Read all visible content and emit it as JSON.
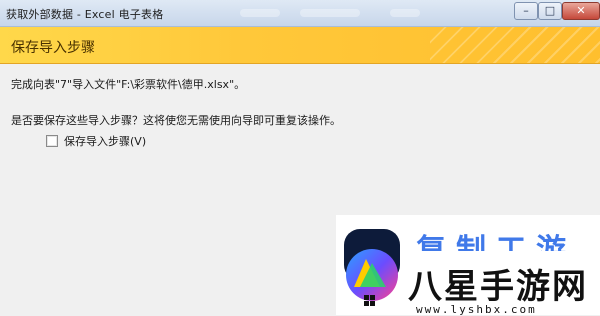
{
  "window": {
    "title": "获取外部数据 - Excel 电子表格",
    "buttons": {
      "minimize_icon": "minimize-icon",
      "maximize_icon": "maximize-icon",
      "close_icon": "close-icon",
      "minimize_glyph": "–",
      "maximize_glyph": "□",
      "close_glyph": "✕"
    }
  },
  "header": {
    "title": "保存导入步骤",
    "color": "#ffc83a"
  },
  "content": {
    "line1": "完成向表\"7\"导入文件\"F:\\彩票软件\\德甲.xlsx\"。",
    "line2": "是否要保存这些导入步骤？这将使您无需使用向导即可重复该操作。",
    "save_checkbox": {
      "label": "保存导入步骤(V)",
      "checked": false
    }
  },
  "watermark": {
    "brand": "八星手游网",
    "url": "www.lyshbx.com",
    "top_text": "复制工游",
    "logo": "game-controller-logo"
  }
}
